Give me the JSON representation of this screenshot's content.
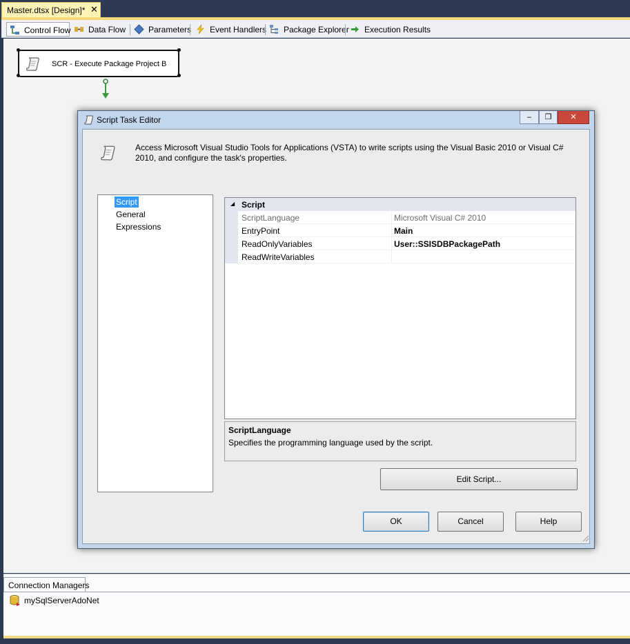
{
  "document_tab": {
    "title": "Master.dtsx [Design]*",
    "close": "✕"
  },
  "designer_tabs": [
    {
      "label": "Control Flow",
      "icon": "control-flow-icon"
    },
    {
      "label": "Data Flow",
      "icon": "data-flow-icon"
    },
    {
      "label": "Parameters",
      "icon": "parameters-icon"
    },
    {
      "label": "Event Handlers",
      "icon": "event-handlers-icon"
    },
    {
      "label": "Package Explorer",
      "icon": "package-explorer-icon"
    },
    {
      "label": "Execution Results",
      "icon": "execution-results-icon"
    }
  ],
  "task": {
    "label": "SCR - Execute Package Project B",
    "icon": "script-icon"
  },
  "connection_managers": {
    "tab_label": "Connection Managers",
    "items": [
      {
        "label": "mySqlServerAdoNet",
        "icon": "database-icon"
      }
    ]
  },
  "dialog": {
    "title": "Script Task Editor",
    "window_buttons": {
      "minimize": "–",
      "restore": "❐",
      "close": "✕"
    },
    "description": "Access Microsoft Visual Studio Tools for Applications (VSTA) to write scripts using the Visual Basic 2010 or Visual C# 2010, and configure the task's properties.",
    "nav": [
      "Script",
      "General",
      "Expressions"
    ],
    "selected_nav": "Script",
    "grid": {
      "category": "Script",
      "rows": [
        {
          "key": "ScriptLanguage",
          "value": "Microsoft Visual C# 2010",
          "disabled": true
        },
        {
          "key": "EntryPoint",
          "value": "Main",
          "bold": true
        },
        {
          "key": "ReadOnlyVariables",
          "value": "User::SSISDBPackagePath",
          "bold": true
        },
        {
          "key": "ReadWriteVariables",
          "value": ""
        }
      ]
    },
    "help": {
      "title": "ScriptLanguage",
      "text": "Specifies the programming language used by the script."
    },
    "buttons": {
      "edit_script": "Edit Script...",
      "ok": "OK",
      "cancel": "Cancel",
      "help": "Help"
    }
  },
  "colors": {
    "selection": "#3399ff",
    "tab_accent": "#f5d87a",
    "title_bar": "#c2d6ee"
  }
}
